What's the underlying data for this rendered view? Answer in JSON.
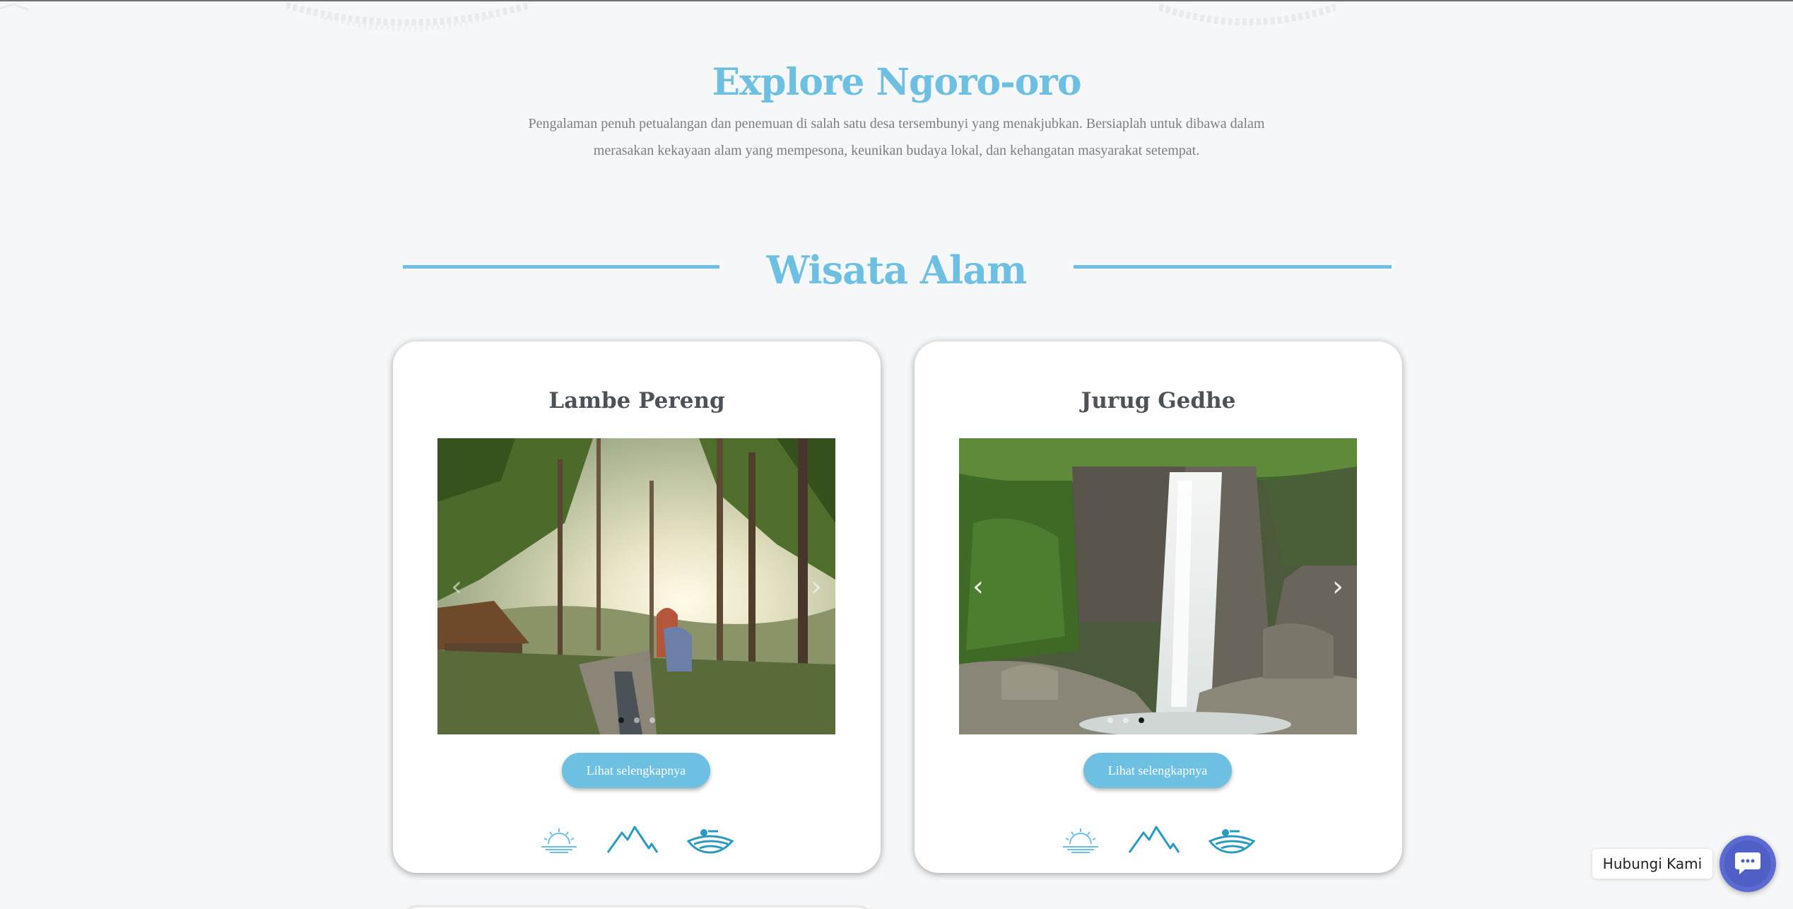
{
  "intro": {
    "title": "Explore Ngoro-oro",
    "description": "Pengalaman penuh petualangan dan penemuan di salah satu desa tersembunyi yang menakjubkan. Bersiaplah untuk dibawa dalam merasakan kekayaan alam yang mempesona, keunikan budaya lokal, dan kehangatan masyarakat setempat."
  },
  "section": {
    "title": "Wisata Alam"
  },
  "cards": [
    {
      "title": "Lambe Pereng",
      "button_label": "Lihat selengkapnya",
      "image": "forest-viewpoint-sunset-photo",
      "active_slide": 1,
      "slide_count": 3
    },
    {
      "title": "Jurug Gedhe",
      "button_label": "Lihat selengkapnya",
      "image": "waterfall-photo",
      "active_slide": 3,
      "slide_count": 3
    }
  ],
  "card_icons": [
    "sunrise-icon",
    "mountain-icon",
    "rice-field-icon"
  ],
  "chat": {
    "label": "Hubungi Kami",
    "icon": "chat-bubble-icon"
  },
  "colors": {
    "accent": "#6ec0e2",
    "heading_dark": "#4d5259",
    "chat": "#5b6bd1"
  }
}
